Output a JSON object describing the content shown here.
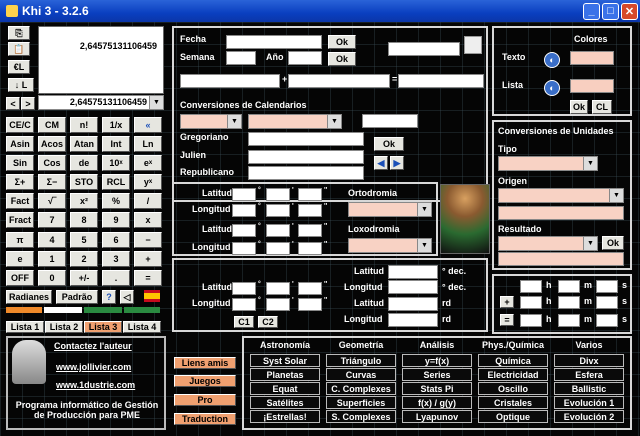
{
  "window": {
    "title": "Khi 3 - 3.2.6",
    "min": "_",
    "max": "□",
    "close": "✕"
  },
  "display": {
    "top_value": "2,64575131106459",
    "combo_value": "2,64575131106459"
  },
  "left_small": {
    "copy": "⎘",
    "paste": "📋",
    "el": "€L",
    "down_l": "↓ L",
    "lt": "<",
    "gt": ">"
  },
  "calc_keys": [
    [
      "CE/C",
      "CM",
      "n!",
      "1/x",
      "«"
    ],
    [
      "Asin",
      "Acos",
      "Atan",
      "Int",
      "Ln"
    ],
    [
      "Sin",
      "Cos",
      "de",
      "10ˣ",
      "eˣ"
    ],
    [
      "Σ+",
      "Σ−",
      "STO",
      "RCL",
      "yˣ"
    ],
    [
      "Fact",
      "√‾",
      "x²",
      "%",
      "/"
    ],
    [
      "Fract",
      "7",
      "8",
      "9",
      "x"
    ],
    [
      "π",
      "4",
      "5",
      "6",
      "−"
    ],
    [
      "e",
      "1",
      "2",
      "3",
      "+"
    ],
    [
      "OFF",
      "0",
      "+/-",
      ".",
      "="
    ]
  ],
  "mode": {
    "rad": "Radianes",
    "pad": "Padrão"
  },
  "lists": [
    "Lista 1",
    "Lista 2",
    "Lista 3",
    "Lista 4"
  ],
  "contact": {
    "title": "Contactez l'auteur",
    "url1": "www.jollivier.com",
    "url2": "www.1dustrie.com",
    "prog": "Programa informático de Gestión de Producción para PME"
  },
  "side_btns": [
    "Liens amis",
    "Juegos",
    "Pro",
    "Traduction"
  ],
  "date": {
    "fecha": "Fecha",
    "semana": "Semana",
    "ano": "Año",
    "ok": "Ok",
    "plus": "+",
    "eq": "=",
    "conv_title": "Conversiones de Calendarios",
    "greg": "Gregoriano",
    "jul": "Julien",
    "rep": "Republicano"
  },
  "colors": {
    "title": "Colores",
    "texto": "Texto",
    "lista": "Lista",
    "ok": "Ok",
    "cl": "CL"
  },
  "units": {
    "title": "Conversiones de Unidades",
    "tipo": "Tipo",
    "origen": "Origen",
    "resultado": "Resultado",
    "ok": "Ok"
  },
  "geo": {
    "lat": "Latitud",
    "lon": "Longitud",
    "orto": "Ortodromia",
    "loxo": "Loxodromia",
    "deg": "°",
    "min": "'",
    "sec": "''"
  },
  "geo2": {
    "lat": "Latitud",
    "lon": "Longitud",
    "dec": "° dec.",
    "rd": "rd",
    "c1": "C1",
    "c2": "C2"
  },
  "time": {
    "h": "h",
    "m": "m",
    "s": "s",
    "plus": "+",
    "eq": "="
  },
  "cats": {
    "headers": [
      "Astronomía",
      "Geometría",
      "Análisis",
      "Phys./Química",
      "Varios"
    ],
    "cols": [
      [
        "Syst Solar",
        "Planetas",
        "Equat",
        "Satélites",
        "¡Estrellas!"
      ],
      [
        "Triángulo",
        "Curvas",
        "C. Complexes",
        "Superficies",
        "S. Complexes"
      ],
      [
        "y=f(x)",
        "Series",
        "Stats Pi",
        "f(x) / g(y)",
        "Lyapunov"
      ],
      [
        "Química",
        "Electricidad",
        "Oscillo",
        "Cristales",
        "Optique"
      ],
      [
        "Divx",
        "Esfera",
        "Ballistic",
        "Evolución 1",
        "Evolución 2"
      ]
    ]
  },
  "accent": "#f0a070"
}
